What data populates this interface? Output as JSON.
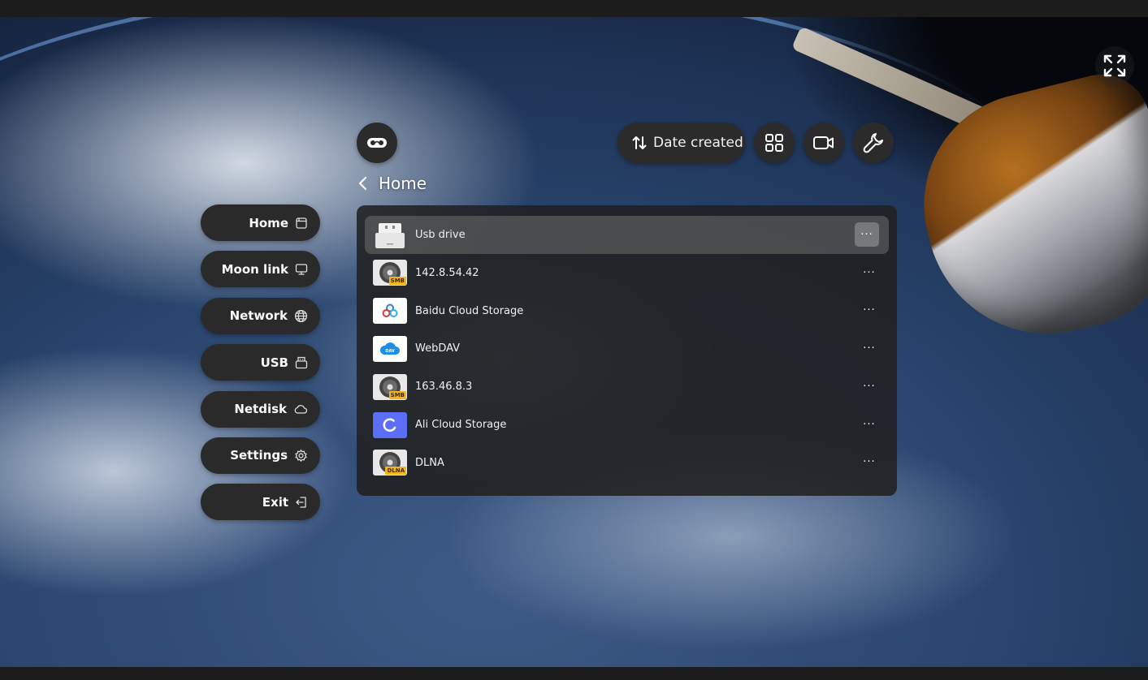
{
  "header": {
    "sort_label": "Date created",
    "icons": {
      "vr": "vr-headset-icon",
      "sort": "sort-arrows-icon",
      "grid": "grid-view-icon",
      "camera": "video-camera-icon",
      "tools": "wrench-icon",
      "fullscreen": "fullscreen-icon"
    }
  },
  "breadcrumb": {
    "back_icon": "chevron-left-icon",
    "title": "Home"
  },
  "sidebar": {
    "items": [
      {
        "label": "Home",
        "icon": "home-icon"
      },
      {
        "label": "Moon link",
        "icon": "monitor-icon"
      },
      {
        "label": "Network",
        "icon": "globe-icon"
      },
      {
        "label": "USB",
        "icon": "usb-icon"
      },
      {
        "label": "Netdisk",
        "icon": "cloud-icon"
      },
      {
        "label": "Settings",
        "icon": "gear-icon"
      },
      {
        "label": "Exit",
        "icon": "exit-icon"
      }
    ]
  },
  "sources": {
    "more_label": "···",
    "items": [
      {
        "name": "Usb drive",
        "type": "usb",
        "selected": true
      },
      {
        "name": "142.8.54.42",
        "type": "smb",
        "badge": "SMB"
      },
      {
        "name": "Baidu Cloud Storage",
        "type": "baidu"
      },
      {
        "name": "WebDAV",
        "type": "webdav",
        "badge": "DAV"
      },
      {
        "name": "163.46.8.3",
        "type": "smb",
        "badge": "SMB"
      },
      {
        "name": "Ali Cloud Storage",
        "type": "ali"
      },
      {
        "name": "DLNA",
        "type": "dlna",
        "badge": "DLNA"
      }
    ]
  },
  "colors": {
    "pill_bg": "#2b2b2b",
    "panel_bg": "#202020",
    "selected_row": "#6e6e6e",
    "badge": "#f3b51b",
    "ali_blue": "#5b6ef5",
    "webdav_blue": "#1d8ee8"
  }
}
